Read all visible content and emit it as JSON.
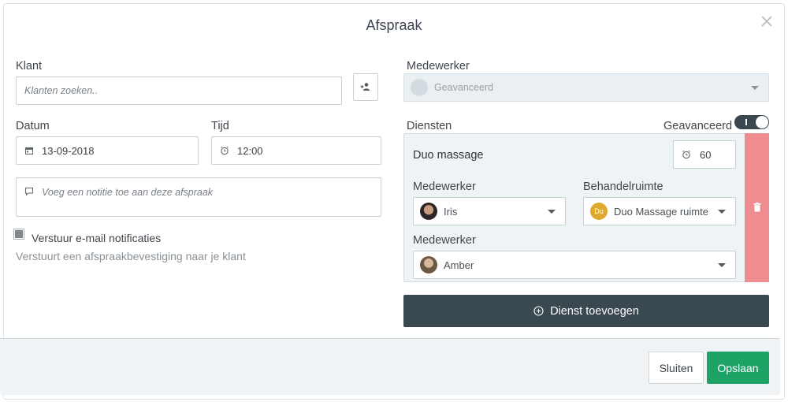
{
  "dialog": {
    "title": "Afspraak"
  },
  "client": {
    "label": "Klant",
    "search_placeholder": "Klanten zoeken.."
  },
  "date": {
    "label": "Datum",
    "value": "13-09-2018"
  },
  "time": {
    "label": "Tijd",
    "value": "12:00"
  },
  "note": {
    "placeholder": "Voeg een notitie toe aan deze afspraak"
  },
  "email_notify": {
    "label": "Verstuur e-mail notificaties",
    "checked": true,
    "help": "Verstuurt een afspraakbevestiging naar je klant"
  },
  "employee": {
    "label": "Medewerker",
    "value": "Geavanceerd"
  },
  "services": {
    "label": "Diensten",
    "advanced_label": "Geavanceerd",
    "advanced_on": true,
    "items": [
      {
        "name": "Duo massage",
        "duration": "60",
        "employee_label_1": "Medewerker",
        "employee_1": "Iris",
        "room_label": "Behandelruimte",
        "room_badge": "Du",
        "room": "Duo Massage ruimte",
        "employee_label_2": "Medewerker",
        "employee_2": "Amber"
      }
    ],
    "add_label": "Dienst toevoegen"
  },
  "footer": {
    "close_label": "Sluiten",
    "save_label": "Opslaan"
  },
  "colors": {
    "primary_dark": "#3a4850",
    "success": "#1ea367",
    "danger": "#ee8c90",
    "room_badge": "#e0a82e"
  }
}
